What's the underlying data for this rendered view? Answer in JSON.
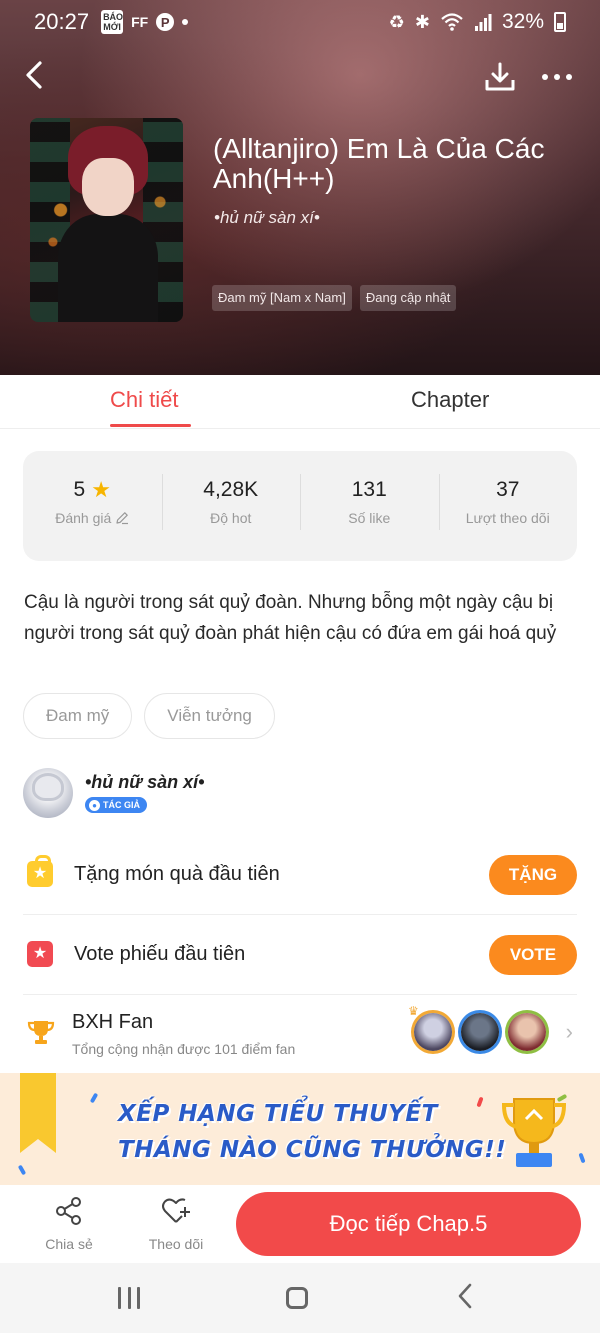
{
  "status_bar": {
    "time": "20:27",
    "badge_text": "BÁO MỚI",
    "ff_text": "FF",
    "battery": "32%"
  },
  "hero": {
    "title": "(Alltanjiro) Em Là Của Các Anh(H++)",
    "author": "•hủ nữ sàn xí•",
    "tags": [
      "Đam mỹ [Nam x Nam]",
      "Đang cập nhật"
    ]
  },
  "tabs": {
    "detail": "Chi tiết",
    "chapter": "Chapter"
  },
  "stats": [
    {
      "value": "5",
      "label": "Đánh giá"
    },
    {
      "value": "4,28K",
      "label": "Độ hot"
    },
    {
      "value": "131",
      "label": "Số like"
    },
    {
      "value": "37",
      "label": "Lượt theo dõi"
    }
  ],
  "description": "Cậu là người trong sát quỷ đoàn. Nhưng bỗng một ngày cậu bị người trong sát quỷ đoàn phát hiện cậu có đứa em gái hoá quỷ",
  "genres": [
    "Đam mỹ",
    "Viễn tưởng"
  ],
  "author_section": {
    "name": "•hủ nữ sàn xí•",
    "badge": "TÁC GIẢ"
  },
  "gift_row": {
    "text": "Tặng món quà đầu tiên",
    "button": "TẶNG"
  },
  "vote_row": {
    "text": "Vote phiếu đầu tiên",
    "button": "VOTE"
  },
  "fan_row": {
    "title": "BXH Fan",
    "subtitle": "Tổng cộng nhận được 101 điểm fan"
  },
  "banner": {
    "line1": "XẾP HẠNG TIỂU THUYẾT",
    "line2": "THÁNG NÀO CŨNG THƯỞNG!!"
  },
  "bottom_bar": {
    "share": "Chia sẻ",
    "follow": "Theo dõi",
    "read": "Đọc tiếp Chap.5"
  },
  "colors": {
    "accent": "#f24a4a",
    "orange_button": "#fb8a1e",
    "star": "#f7b500",
    "banner_text": "#2a5bc7"
  }
}
